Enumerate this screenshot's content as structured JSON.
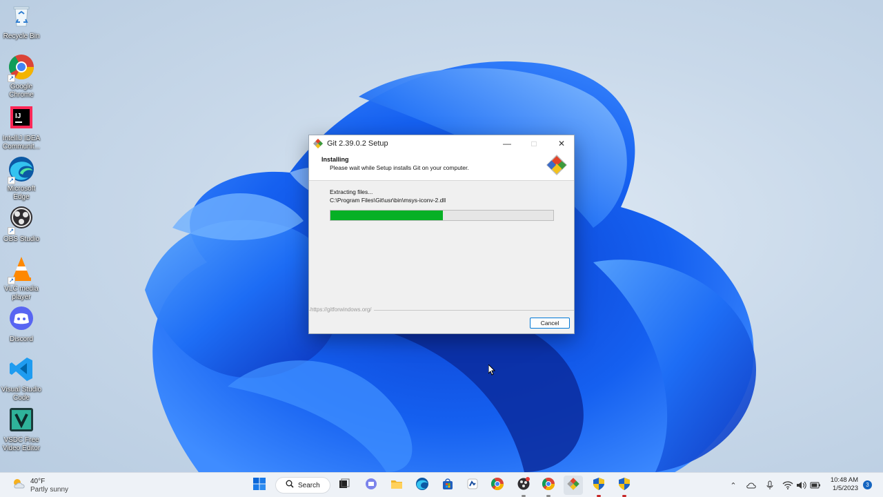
{
  "desktop": {
    "icons": [
      {
        "label": "Recycle Bin",
        "icon": "recycle-bin-icon"
      },
      {
        "label": "Google Chrome",
        "icon": "chrome-icon"
      },
      {
        "label": "IntelliJ IDEA Communit...",
        "icon": "intellij-icon"
      },
      {
        "label": "Microsoft Edge",
        "icon": "edge-icon"
      },
      {
        "label": "OBS Studio",
        "icon": "obs-icon"
      },
      {
        "label": "VLC media player",
        "icon": "vlc-icon"
      },
      {
        "label": "Discord",
        "icon": "discord-icon"
      },
      {
        "label": "Visual Studio Code",
        "icon": "vscode-icon"
      },
      {
        "label": "VSDC Free Video Editor",
        "icon": "vsdc-icon"
      }
    ]
  },
  "dialog": {
    "title": "Git 2.39.0.2 Setup",
    "header_title": "Installing",
    "header_subtitle": "Please wait while Setup installs Git on your computer.",
    "status_line": "Extracting files...",
    "current_file": "C:\\Program Files\\Git\\usr\\bin\\msys-iconv-2.dll",
    "progress_fraction": 0.505,
    "footer_url": "https://gitforwindows.org/",
    "cancel_label": "Cancel",
    "progress_color": "#06b025"
  },
  "taskbar": {
    "weather_temp": "40°F",
    "weather_desc": "Partly sunny",
    "search_label": "Search",
    "apps": [
      "start-icon",
      "search-icon",
      "task-view-icon",
      "teams-chat-icon",
      "file-explorer-icon",
      "edge-icon",
      "store-icon",
      "app-icon",
      "chrome-icon",
      "obs-icon",
      "chrome-icon",
      "git-setup-icon",
      "security-shield-icon",
      "security-shield-icon"
    ],
    "clock_time": "10:48 AM",
    "clock_date": "1/5/2023",
    "notification_count": "3"
  }
}
